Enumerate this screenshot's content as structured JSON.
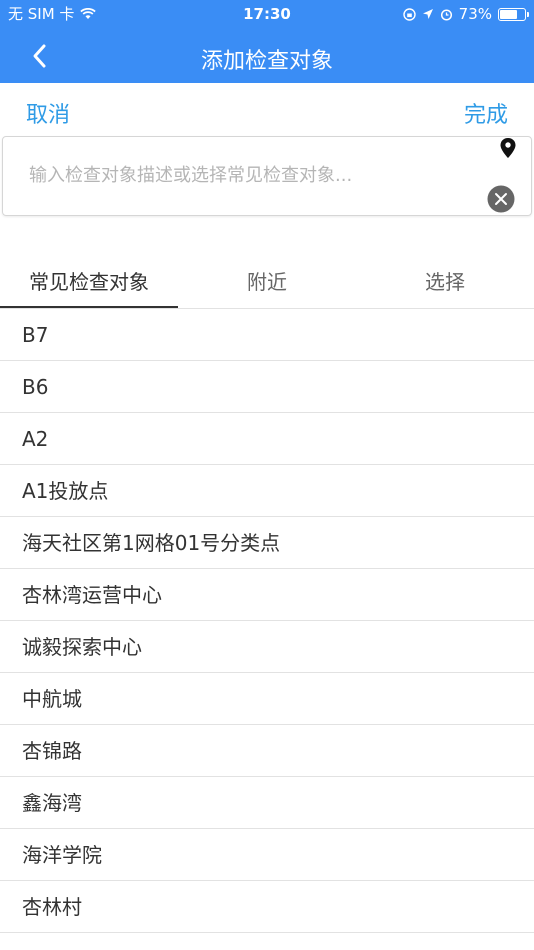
{
  "status_bar": {
    "carrier": "无 SIM 卡",
    "time": "17:30",
    "battery": "73%",
    "battery_level": 0.73
  },
  "nav": {
    "title": "添加检查对象",
    "back_icon": "chevron-left-icon"
  },
  "actions": {
    "cancel_label": "取消",
    "done_label": "完成"
  },
  "search": {
    "placeholder": "输入检查对象描述或选择常见检查对象..."
  },
  "tabs": [
    {
      "label": "常见检查对象",
      "active": true
    },
    {
      "label": "附近",
      "active": false
    },
    {
      "label": "选择",
      "active": false
    }
  ],
  "items": [
    "B7",
    "B6",
    "A2",
    "A1投放点",
    "海天社区第1网格01号分类点",
    "杏林湾运营中心",
    "诚毅探索中心",
    "中航城",
    "杏锦路",
    "鑫海湾",
    "海洋学院",
    "杏林村"
  ],
  "colors": {
    "header": "#3a8df5",
    "accent": "#2f9be6"
  }
}
